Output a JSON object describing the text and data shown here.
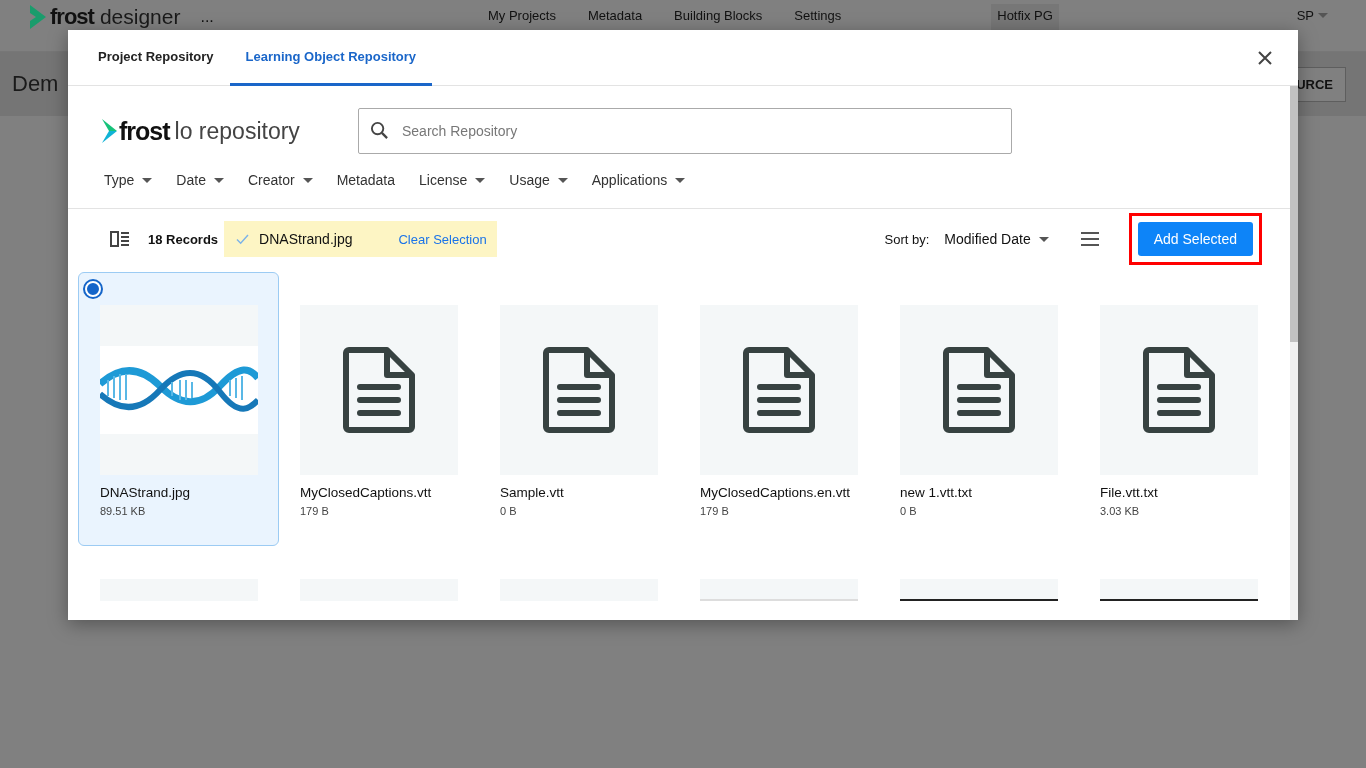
{
  "app_bar": {
    "logo_word": "frost",
    "logo_suffix": "designer",
    "more": "...",
    "nav": [
      "My Projects",
      "Metadata",
      "Building Blocks",
      "Settings"
    ],
    "project": "Hotfix PG",
    "user": "SP"
  },
  "page": {
    "title": "Dem",
    "action": "URCE"
  },
  "dialog": {
    "tabs": [
      {
        "label": "Project Repository",
        "selected": false
      },
      {
        "label": "Learning Object Repository",
        "selected": true
      }
    ],
    "logo": {
      "word": "frost",
      "suffix": "lo repository"
    },
    "search": {
      "placeholder": "Search Repository"
    },
    "filters": [
      {
        "label": "Type",
        "dropdown": true
      },
      {
        "label": "Date",
        "dropdown": true
      },
      {
        "label": "Creator",
        "dropdown": true
      },
      {
        "label": "Metadata",
        "dropdown": false
      },
      {
        "label": "License",
        "dropdown": true
      },
      {
        "label": "Usage",
        "dropdown": true
      },
      {
        "label": "Applications",
        "dropdown": true
      }
    ],
    "records": "18 Records",
    "selection": {
      "name": "DNAStrand.jpg",
      "clear": "Clear Selection"
    },
    "sort": {
      "label": "Sort by:",
      "value": "Modified Date"
    },
    "add_button": {
      "label": "Add Selected",
      "highlighted": true
    },
    "items": [
      {
        "name": "DNAStrand.jpg",
        "size": "89.51 KB",
        "selected": true
      },
      {
        "kind": "document",
        "name": "MyClosedCaptions.vtt",
        "size": "179 B",
        "selected": false
      },
      {
        "kind": "document",
        "name": "Sample.vtt",
        "size": "0 B",
        "selected": false
      },
      {
        "kind": "document",
        "name": "MyClosedCaptions.en.vtt",
        "size": "179 B",
        "selected": false
      },
      {
        "kind": "document",
        "name": "new 1.vtt.txt",
        "size": "0 B",
        "selected": false
      },
      {
        "kind": "document",
        "name": "File.vtt.txt",
        "size": "3.03 KB",
        "selected": false
      }
    ],
    "next_row": [
      {
        "kind": "plain"
      },
      {
        "kind": "plain"
      },
      {
        "kind": "plain"
      },
      {
        "kind": "light-rule"
      },
      {
        "kind": "dark-rule"
      },
      {
        "kind": "dark-rule"
      }
    ]
  }
}
